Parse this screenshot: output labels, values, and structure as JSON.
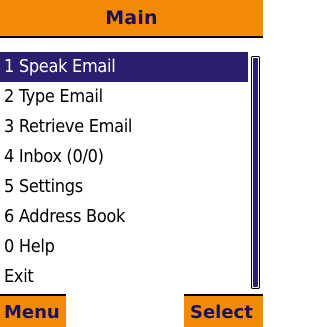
{
  "title": "Main",
  "menu": {
    "items": [
      {
        "label": "1 Speak Email",
        "selected": true
      },
      {
        "label": "2 Type Email",
        "selected": false
      },
      {
        "label": "3 Retrieve Email",
        "selected": false
      },
      {
        "label": "4 Inbox (0/0)",
        "selected": false
      },
      {
        "label": "5 Settings",
        "selected": false
      },
      {
        "label": "6 Address Book",
        "selected": false
      },
      {
        "label": "0 Help",
        "selected": false
      },
      {
        "label": "Exit",
        "selected": false
      }
    ]
  },
  "softkeys": {
    "left": "Menu",
    "right": "Select"
  },
  "colors": {
    "accent": "#f38a05",
    "selection": "#2a1e6e",
    "title_text": "#1a1060"
  }
}
